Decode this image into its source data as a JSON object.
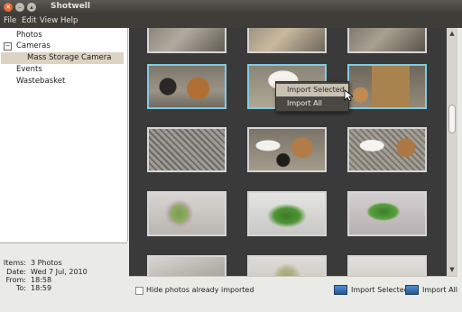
{
  "window": {
    "title": "Shotwell"
  },
  "menubar": {
    "items": [
      "File",
      "Edit",
      "View",
      "Help"
    ]
  },
  "sidebar": {
    "photos": "Photos",
    "cameras": "Cameras",
    "camera_device": "Mass Storage Camera",
    "events": "Events",
    "wastebasket": "Wastebasket"
  },
  "meta": {
    "items_label": "Items:",
    "items_value": "3 Photos",
    "date_label": "Date:",
    "date_value": "Wed 7 Jul, 2010",
    "from_label": "From:",
    "from_value": "18:58",
    "to_label": "To:",
    "to_value": "18:59"
  },
  "context_menu": {
    "import_selected": "Import Selected",
    "import_all": "Import All"
  },
  "bottom": {
    "hide_imported": "Hide photos already imported",
    "import_selected": "Import Selected",
    "import_all": "Import All"
  },
  "colors": {
    "selection_border": "#82cbe0",
    "grid_bg": "#3a3a3a",
    "sidebar_selected": "#dcd3c4"
  },
  "icons": [
    "close-icon",
    "minimize-icon",
    "maximize-icon",
    "expander-minus-icon",
    "scroll-up-icon",
    "scroll-down-icon",
    "import-icon",
    "mouse-cursor-icon"
  ]
}
